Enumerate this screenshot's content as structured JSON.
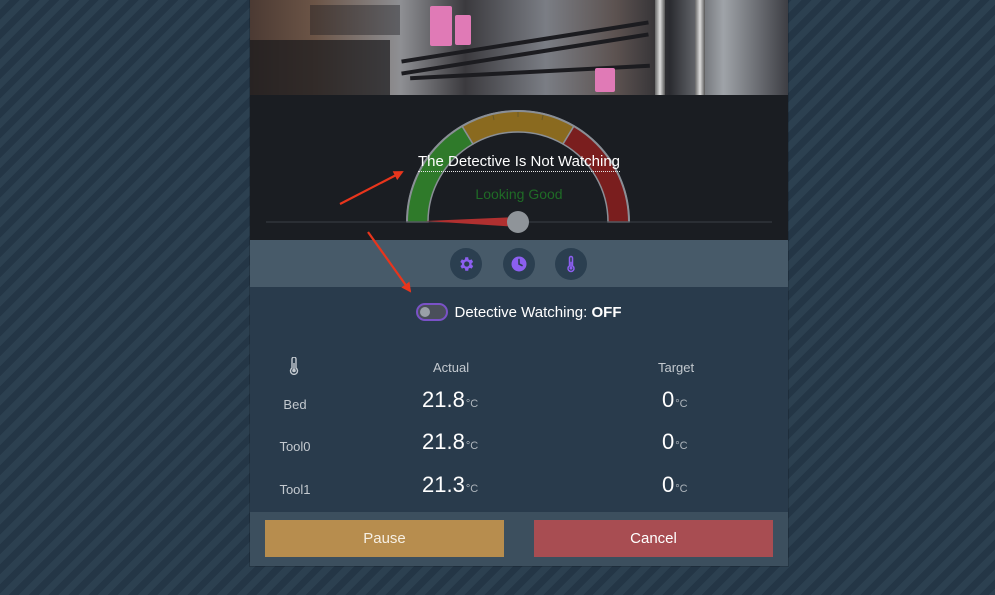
{
  "camera": {
    "description_icon": "printer-camera-feed"
  },
  "gauge": {
    "detective_text": "The Detective Is Not Watching",
    "status_text": "Looking Good",
    "level": 0.05,
    "colors": {
      "good": "#2f7a2a",
      "warn": "#8a6a1f",
      "bad": "#7a1e1e",
      "status_text": "#1f6b26"
    }
  },
  "toolbar": {
    "icons": [
      "gear-icon",
      "clock-icon",
      "thermometer-icon"
    ],
    "accent": "#8c5ff0"
  },
  "detective_toggle": {
    "label": "Detective Watching:",
    "state": "OFF",
    "checked": false
  },
  "temperatures": {
    "icon": "thermometer-icon",
    "actual_header": "Actual",
    "target_header": "Target",
    "unit": "°C",
    "rows": [
      {
        "name": "Bed",
        "actual": "21.8",
        "target": "0"
      },
      {
        "name": "Tool0",
        "actual": "21.8",
        "target": "0"
      },
      {
        "name": "Tool1",
        "actual": "21.3",
        "target": "0"
      }
    ]
  },
  "actions": {
    "pause_label": "Pause",
    "cancel_label": "Cancel",
    "colors": {
      "pause": "#b78d4e",
      "cancel": "#a84d52"
    }
  },
  "annotation": {
    "arrow_color": "#e8351c"
  }
}
